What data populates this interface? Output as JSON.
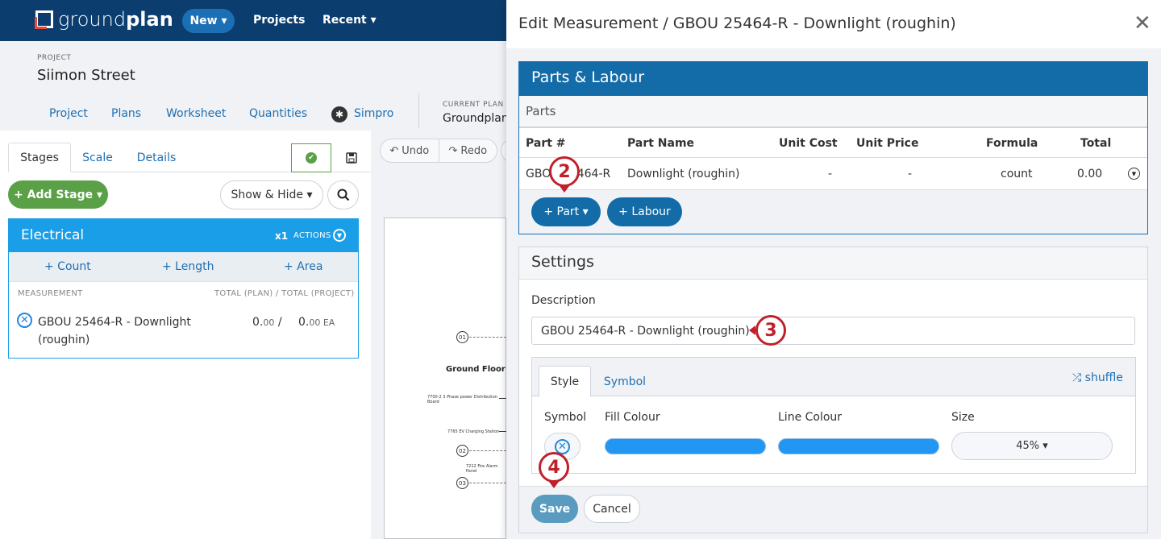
{
  "topnav": {
    "logo_light": "ground",
    "logo_bold": "plan",
    "new_label": "New ▾",
    "projects_label": "Projects",
    "recent_label": "Recent ▾"
  },
  "project": {
    "label": "PROJECT",
    "name": "Siimon Street",
    "tabs": [
      "Project",
      "Plans",
      "Worksheet",
      "Quantities",
      "Simpro"
    ],
    "current_plan_label": "CURRENT PLAN",
    "current_plan_name": "Groundplan"
  },
  "left": {
    "tabs": [
      "Stages",
      "Scale",
      "Details"
    ],
    "add_stage_label": "+ Add Stage ▾",
    "show_hide_label": "Show & Hide ▾",
    "stage": {
      "title": "Electrical",
      "multiplier": "x1",
      "actions_label": "ACTIONS",
      "add_count": "+ Count",
      "add_length": "+ Length",
      "add_area": "+ Area",
      "col_measurement": "MEASUREMENT",
      "col_totals": "TOTAL (PLAN) / TOTAL (PROJECT)",
      "measurement_name": "GBOU 25464-R - Downlight (roughin)",
      "plan_total_int": "0.",
      "plan_total_dec": "00",
      "project_total_int": "0.",
      "project_total_dec": "00 EA",
      "separator": "/"
    }
  },
  "toolbar": {
    "undo_label": "Undo",
    "redo_label": "Redo"
  },
  "plan": {
    "floor_label": "Ground Floor",
    "markers": [
      "01",
      "02",
      "03"
    ],
    "items": [
      "7700-2 3 Phase power Distribution Board",
      "7765 EV Charging Station",
      "7212 Fire Alarm Panel"
    ]
  },
  "modal": {
    "title": "Edit Measurement / GBOU 25464-R - Downlight (roughin)",
    "close_icon": "close-icon",
    "parts_labour_title": "Parts & Labour",
    "parts_subtitle": "Parts",
    "columns": [
      "Part #",
      "Part Name",
      "Unit Cost",
      "Unit Price",
      "Formula",
      "Total"
    ],
    "row": {
      "part_no": "GBOU 25464-R",
      "part_name": "Downlight (roughin)",
      "unit_cost": "-",
      "unit_price": "-",
      "formula": "count",
      "total": "0.00"
    },
    "add_part_label": "+ Part ▾",
    "add_labour_label": "+ Labour",
    "settings_title": "Settings",
    "description_label": "Description",
    "description_value": "GBOU 25464-R - Downlight (roughin)",
    "style_tabs": [
      "Style",
      "Symbol"
    ],
    "shuffle_label": "shuffle",
    "symbol_label": "Symbol",
    "fill_label": "Fill Colour",
    "line_label": "Line Colour",
    "size_label": "Size",
    "fill_color": "#2196f3",
    "line_color": "#2196f3",
    "size_value": "45% ▾",
    "save_label": "Save",
    "cancel_label": "Cancel"
  },
  "callouts": [
    "2",
    "3",
    "4"
  ],
  "colors": {
    "nav_bg": "#0b3d6e",
    "accent_blue": "#136ba8",
    "stage_blue": "#1a9ee8",
    "green": "#5aa046",
    "callout_red": "#c0202a"
  }
}
